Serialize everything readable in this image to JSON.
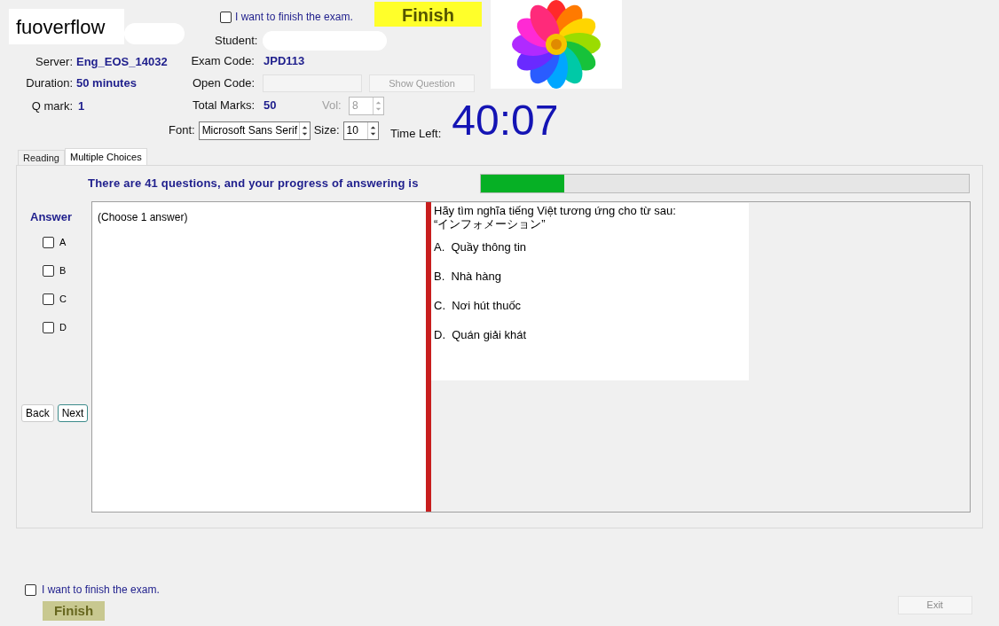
{
  "logo_text": "fuoverflow",
  "finish_confirm": {
    "label": "I want to finish the exam.",
    "checked": false
  },
  "finish_button": {
    "label": "Finish",
    "disabled": false
  },
  "student": {
    "label": "Student:"
  },
  "server": {
    "label": "Server:",
    "value": "Eng_EOS_14032"
  },
  "duration": {
    "label": "Duration:",
    "value": "50 minutes"
  },
  "q_mark": {
    "label": "Q mark:",
    "value": "1"
  },
  "exam_code": {
    "label": "Exam Code:",
    "value": "JPD113"
  },
  "open_code": {
    "label": "Open Code:",
    "disabled": true
  },
  "show_question": {
    "label": "Show Question",
    "disabled": true
  },
  "total_marks": {
    "label": "Total Marks:",
    "value": "50"
  },
  "vol": {
    "label": "Vol:",
    "value": "8",
    "disabled": true
  },
  "font": {
    "label": "Font:",
    "value": "Microsoft Sans Serif"
  },
  "size": {
    "label": "Size:",
    "value": "10"
  },
  "time_left": {
    "label": "Time Left:",
    "value": "40:07"
  },
  "tabs": [
    {
      "label": "Reading",
      "selected": false
    },
    {
      "label": "Multiple Choices",
      "selected": true
    }
  ],
  "progress": {
    "text": "There are 41 questions, and your progress of answering is",
    "level": 0.17
  },
  "answer": {
    "title": "Answer",
    "options": [
      {
        "label": "A",
        "checked": false
      },
      {
        "label": "B",
        "checked": false
      },
      {
        "label": "C",
        "checked": false
      },
      {
        "label": "D",
        "checked": false
      }
    ]
  },
  "nav_buttons": [
    {
      "label": "Back",
      "focused": false
    },
    {
      "label": "Next",
      "focused": true
    }
  ],
  "answer_hint": "(Choose 1 answer)",
  "question": {
    "lines": [
      "Hãy tìm nghĩa tiếng Việt tương ứng cho từ sau:",
      "“インフォメーション”"
    ],
    "choices": [
      {
        "letter": "A.",
        "text": "Quầy thông tin"
      },
      {
        "letter": "B.",
        "text": "Nhà hàng"
      },
      {
        "letter": "C.",
        "text": "Nơi hút thuốc"
      },
      {
        "letter": "D.",
        "text": "Quán giải khát"
      }
    ]
  },
  "bottom_confirm": {
    "label": "I want to finish the exam.",
    "checked": false
  },
  "bottom_finish_button": {
    "label": "Finish",
    "disabled": true
  },
  "exit_button": {
    "label": "Exit",
    "disabled": true
  }
}
